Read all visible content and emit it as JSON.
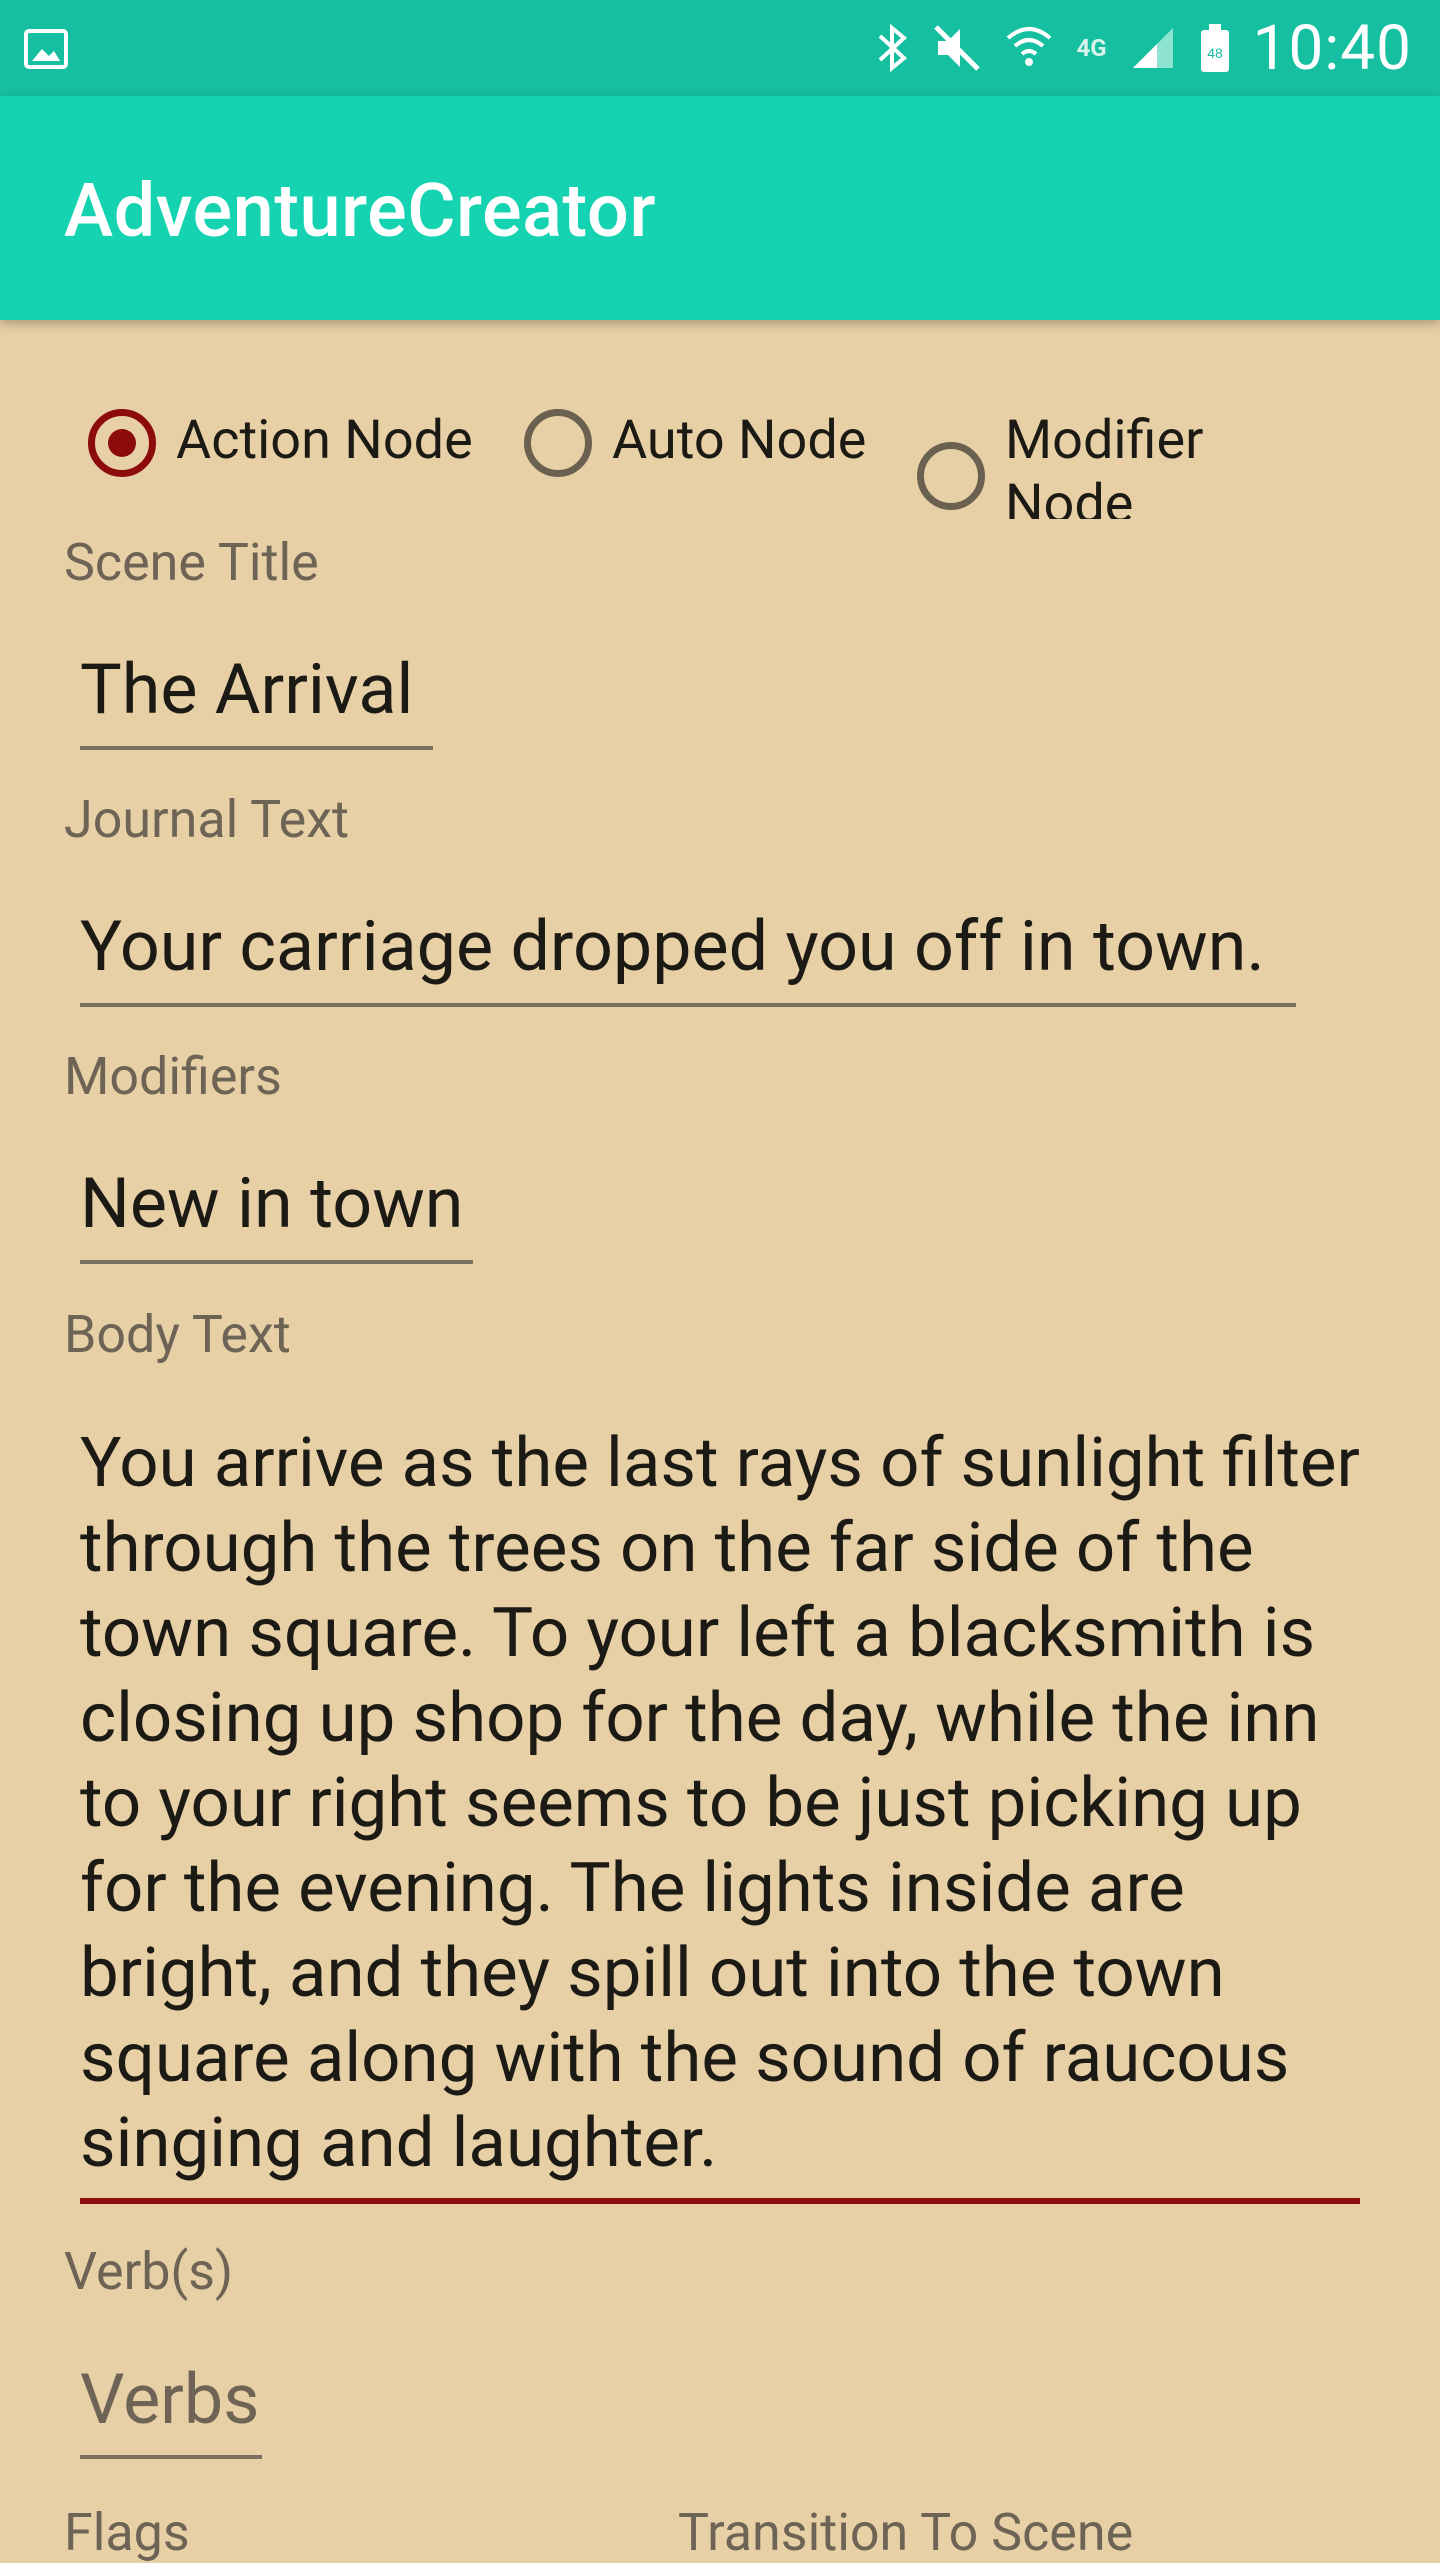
{
  "status_bar": {
    "time": "10:40",
    "icons": [
      "image-icon",
      "bluetooth-icon",
      "mute-icon",
      "wifi-icon",
      "lte-icon",
      "signal-icon",
      "battery-icon"
    ],
    "battery_level": "48",
    "network_label": "4G"
  },
  "app_bar": {
    "title": "AdventureCreator"
  },
  "node_type": {
    "options": [
      {
        "label": "Action Node",
        "checked": true
      },
      {
        "label": "Auto Node",
        "checked": false
      },
      {
        "label": "Modifier Node",
        "checked": false
      }
    ]
  },
  "form": {
    "scene_title": {
      "label": "Scene Title",
      "value": "The Arrival"
    },
    "journal_text": {
      "label": "Journal Text",
      "value": "Your carriage dropped you off in town."
    },
    "modifiers": {
      "label": "Modifiers",
      "value": "New in town"
    },
    "body_text": {
      "label": "Body Text",
      "value": "You arrive as the last rays of sunlight filter through the trees on the far side of the town square. To your left a blacksmith is closing up shop for the day, while the inn to your right seems to be just picking up for the evening. The lights inside are bright, and they spill out into the town square along with the sound of raucous singing and laughter."
    },
    "verbs": {
      "label": "Verb(s)",
      "placeholder": "Verbs"
    },
    "flags": {
      "label": "Flags"
    },
    "transition": {
      "label": "Transition To Scene"
    }
  },
  "colors": {
    "status_bar": "#16bfa0",
    "app_bar": "#15d3b1",
    "background": "#e8d0a6",
    "accent": "#8c0b0b"
  }
}
